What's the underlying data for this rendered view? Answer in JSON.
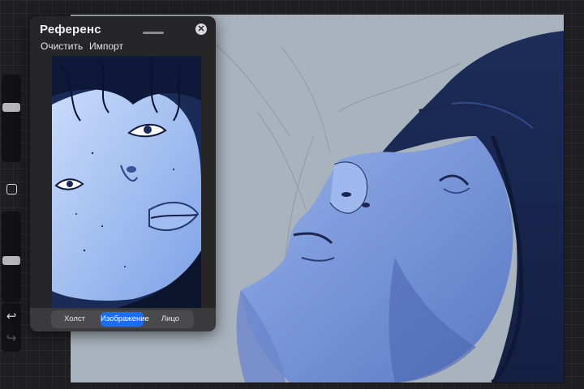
{
  "reference_panel": {
    "title": "Референс",
    "close_label": "✕",
    "actions": {
      "clear": "Очистить",
      "import": "Импорт"
    },
    "modes": [
      {
        "label": "Холст",
        "selected": false
      },
      {
        "label": "Изображение",
        "selected": true
      },
      {
        "label": "Лицо",
        "selected": false
      }
    ]
  },
  "sidebar": {
    "undo_icon": "undo-icon",
    "redo_icon": "redo-icon",
    "modify_icon": "square-icon",
    "brush_size_level": 0.65,
    "opacity_level": 0.45
  },
  "colors": {
    "accent": "#1b6ef3",
    "panel_bg": "#262628",
    "canvas_bg": "#a9b3bd",
    "drawing_blue": "#6f8fd6",
    "drawing_dark": "#1d2c55"
  }
}
